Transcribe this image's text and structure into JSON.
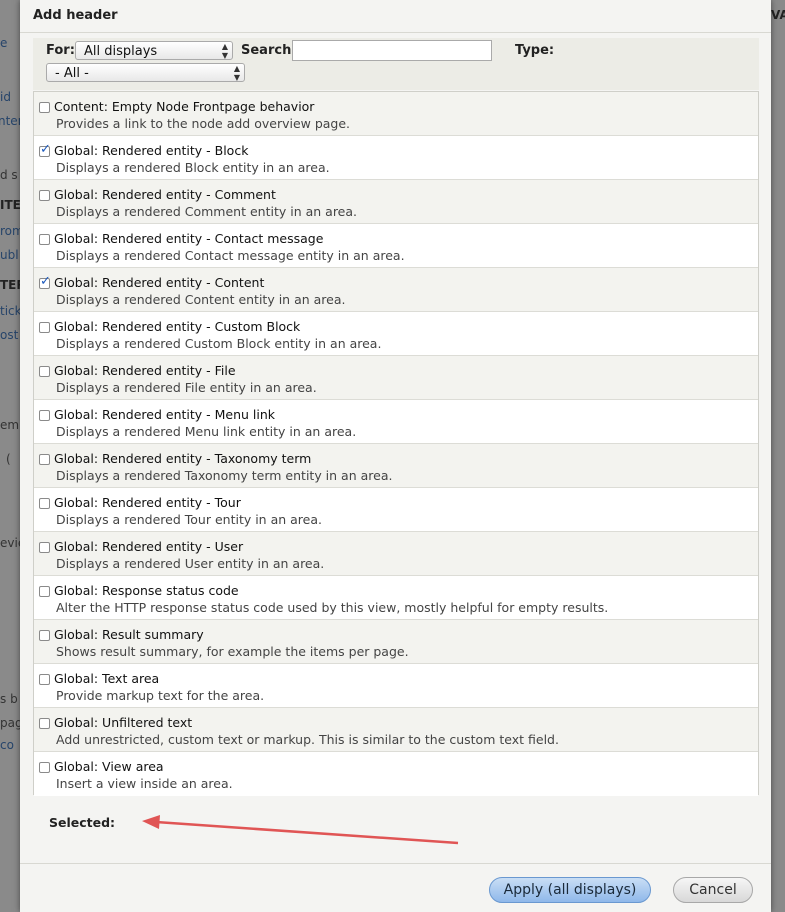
{
  "dialog": {
    "title": "Add header"
  },
  "filters": {
    "for_label": "For:",
    "for_value": "All displays",
    "search_label": "Search:",
    "search_value": "",
    "type_label": "Type:",
    "category_value": "- All -"
  },
  "options": [
    {
      "title": "Content: Empty Node Frontpage behavior",
      "desc": "Provides a link to the node add overview page.",
      "checked": false
    },
    {
      "title": "Global: Rendered entity - Block",
      "desc": "Displays a rendered Block entity in an area.",
      "checked": true
    },
    {
      "title": "Global: Rendered entity - Comment",
      "desc": "Displays a rendered Comment entity in an area.",
      "checked": false
    },
    {
      "title": "Global: Rendered entity - Contact message",
      "desc": "Displays a rendered Contact message entity in an area.",
      "checked": false
    },
    {
      "title": "Global: Rendered entity - Content",
      "desc": "Displays a rendered Content entity in an area.",
      "checked": true
    },
    {
      "title": "Global: Rendered entity - Custom Block",
      "desc": "Displays a rendered Custom Block entity in an area.",
      "checked": false
    },
    {
      "title": "Global: Rendered entity - File",
      "desc": "Displays a rendered File entity in an area.",
      "checked": false
    },
    {
      "title": "Global: Rendered entity - Menu link",
      "desc": "Displays a rendered Menu link entity in an area.",
      "checked": false
    },
    {
      "title": "Global: Rendered entity - Taxonomy term",
      "desc": "Displays a rendered Taxonomy term entity in an area.",
      "checked": false
    },
    {
      "title": "Global: Rendered entity - Tour",
      "desc": "Displays a rendered Tour entity in an area.",
      "checked": false
    },
    {
      "title": "Global: Rendered entity - User",
      "desc": "Displays a rendered User entity in an area.",
      "checked": false
    },
    {
      "title": "Global: Response status code",
      "desc": "Alter the HTTP response status code used by this view, mostly helpful for empty results.",
      "checked": false
    },
    {
      "title": "Global: Result summary",
      "desc": "Shows result summary, for example the items per page.",
      "checked": false
    },
    {
      "title": "Global: Text area",
      "desc": "Provide markup text for the area.",
      "checked": false
    },
    {
      "title": "Global: Unfiltered text",
      "desc": "Add unrestricted, custom text or markup. This is similar to the custom text field.",
      "checked": false
    },
    {
      "title": "Global: View area",
      "desc": "Insert a view inside an area.",
      "checked": false
    }
  ],
  "selected_label": "Selected:",
  "buttons": {
    "apply": "Apply (all displays)",
    "cancel": "Cancel"
  },
  "background": {
    "left_fragments": [
      "e",
      "id",
      "ntent",
      "d s",
      "ITE",
      "rom",
      "ubl",
      "TER",
      "tick",
      "ost",
      "em",
      "(",
      "evie",
      "s b",
      "pag",
      "co"
    ],
    "right_fragments": [
      "VA"
    ]
  },
  "colors": {
    "accent": "#8fb8ea",
    "annotation_arrow": "#e05555",
    "checkbox_check": "#1e5bbd"
  }
}
